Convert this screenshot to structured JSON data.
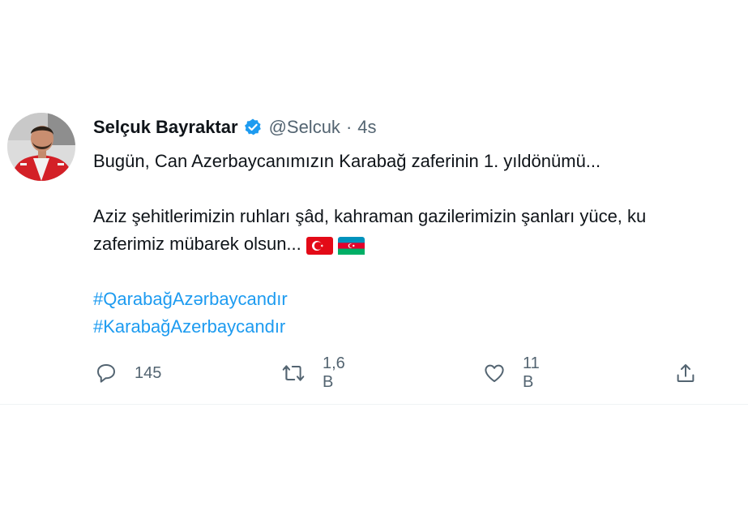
{
  "tweet": {
    "author": {
      "name": "Selçuk Bayraktar",
      "handle": "@Selcuk",
      "separator": "·",
      "time": "4s"
    },
    "text": {
      "line1": "Bugün, Can Azerbaycanımızın Karabağ zaferinin 1. yıldönümü...",
      "line2": "Aziz şehitlerimizin ruhları şâd, kahraman gazilerimizin şanları yüce, ku",
      "line3": "zaferimiz mübarek olsun..."
    },
    "flags": [
      "turkey-flag",
      "azerbaijan-flag"
    ],
    "hashtags": [
      "#QarabağAzərbaycandır",
      "#KarabağAzerbaycandır"
    ],
    "actions": {
      "reply_count": "145",
      "retweet_count": "1,6 B",
      "like_count": "11 B"
    },
    "colors": {
      "text": "#0f1419",
      "secondary": "#536471",
      "link": "#1d9bf0",
      "verified": "#1d9bf0"
    }
  }
}
